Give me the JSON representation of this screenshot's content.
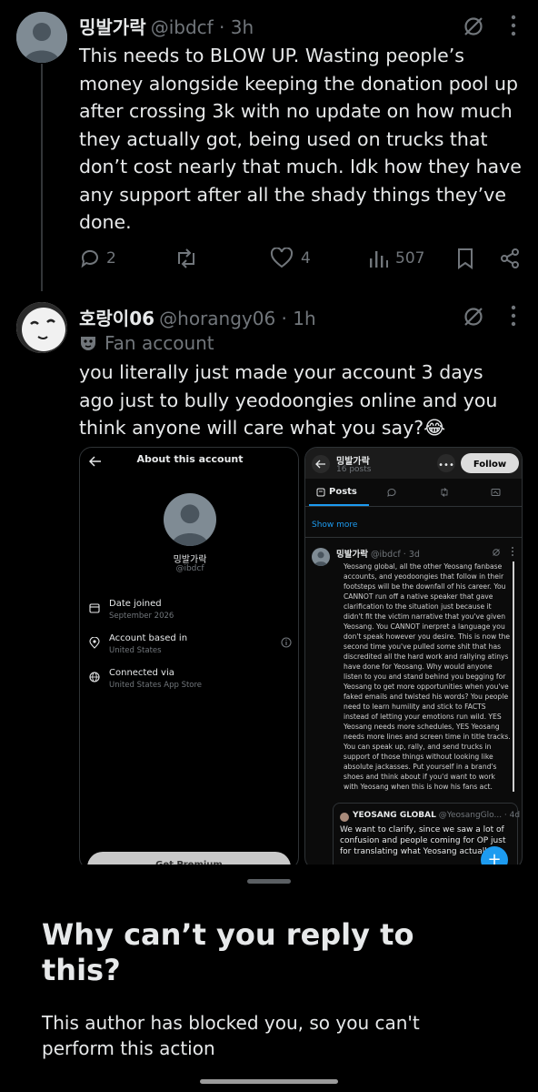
{
  "tweet1": {
    "display_name": "밍발가락",
    "handle_time": "@ibdcf · 3h",
    "text": "This needs to BLOW UP. Wasting people’s money alongside keeping the donation pool up after crossing 3k with no update on how much they actually got, being used on trucks that don’t cost nearly that much. Idk how they have any support after all the shady things they’ve done.",
    "replies": "2",
    "likes": "4",
    "views": "507"
  },
  "tweet2": {
    "display_name": "호랑이06",
    "handle_time": "@horangy06 · 1h",
    "label": "Fan account",
    "text": "you literally just made your account 3 days ago just to bully yeodoongies online and you think anyone will care what you say?😂"
  },
  "shot_left": {
    "title": "About this account",
    "name": "밍발가락",
    "handle": "@ibdcf",
    "rows": [
      {
        "label": "Date joined",
        "value": "September 2026"
      },
      {
        "label": "Account based in",
        "value": "United States"
      },
      {
        "label": "Connected via",
        "value": "United States App Store"
      }
    ],
    "premium": "Get Premium"
  },
  "shot_right": {
    "name": "밍발가락",
    "posts_count": "16 posts",
    "follow": "Follow",
    "tab_posts": "Posts",
    "show_more": "Show more",
    "tweet_name": "밍발가락",
    "tweet_meta": "@ibdcf · 3d",
    "tweet_text": "Yeosang global, all the other Yeosang fanbase accounts, and yeodoongies that follow in their footsteps will be the downfall of his career. You CANNOT run off a native speaker that gave clarification to the situation just because it didn't fit the victim narrative that you've given Yeosang. You CANNOT inerpret a language you don't speak however you desire. This is now the second time you've pulled some shit that has discredited all the hard work and rallying atinys have done for Yeosang. Why would anyone listen to you and stand behind you begging for Yeosang to get more opportunities when you've faked emails and twisted his words? You people need to learn humility and stick to FACTS instead of letting your emotions run wild. YES Yeosang needs more schedules, YES Yeosang needs more lines and screen time in title tracks. You can speak up, rally, and send trucks in support of those things without looking like absolute jackasses. Put yourself in a brand's shoes and think about if you'd want to work with Yeosang when this is how his fans act.",
    "quote_name": "YEOSANG GLOBAL",
    "quote_meta": "@YeosangGlo... · 4d",
    "quote_text": "We want to clarify, since we saw a lot of confusion and people coming for OP just for translating what Yeosang actually"
  },
  "sheet": {
    "title": "Why can’t you reply to this?",
    "body": "This author has blocked you, so you can't perform this action"
  }
}
